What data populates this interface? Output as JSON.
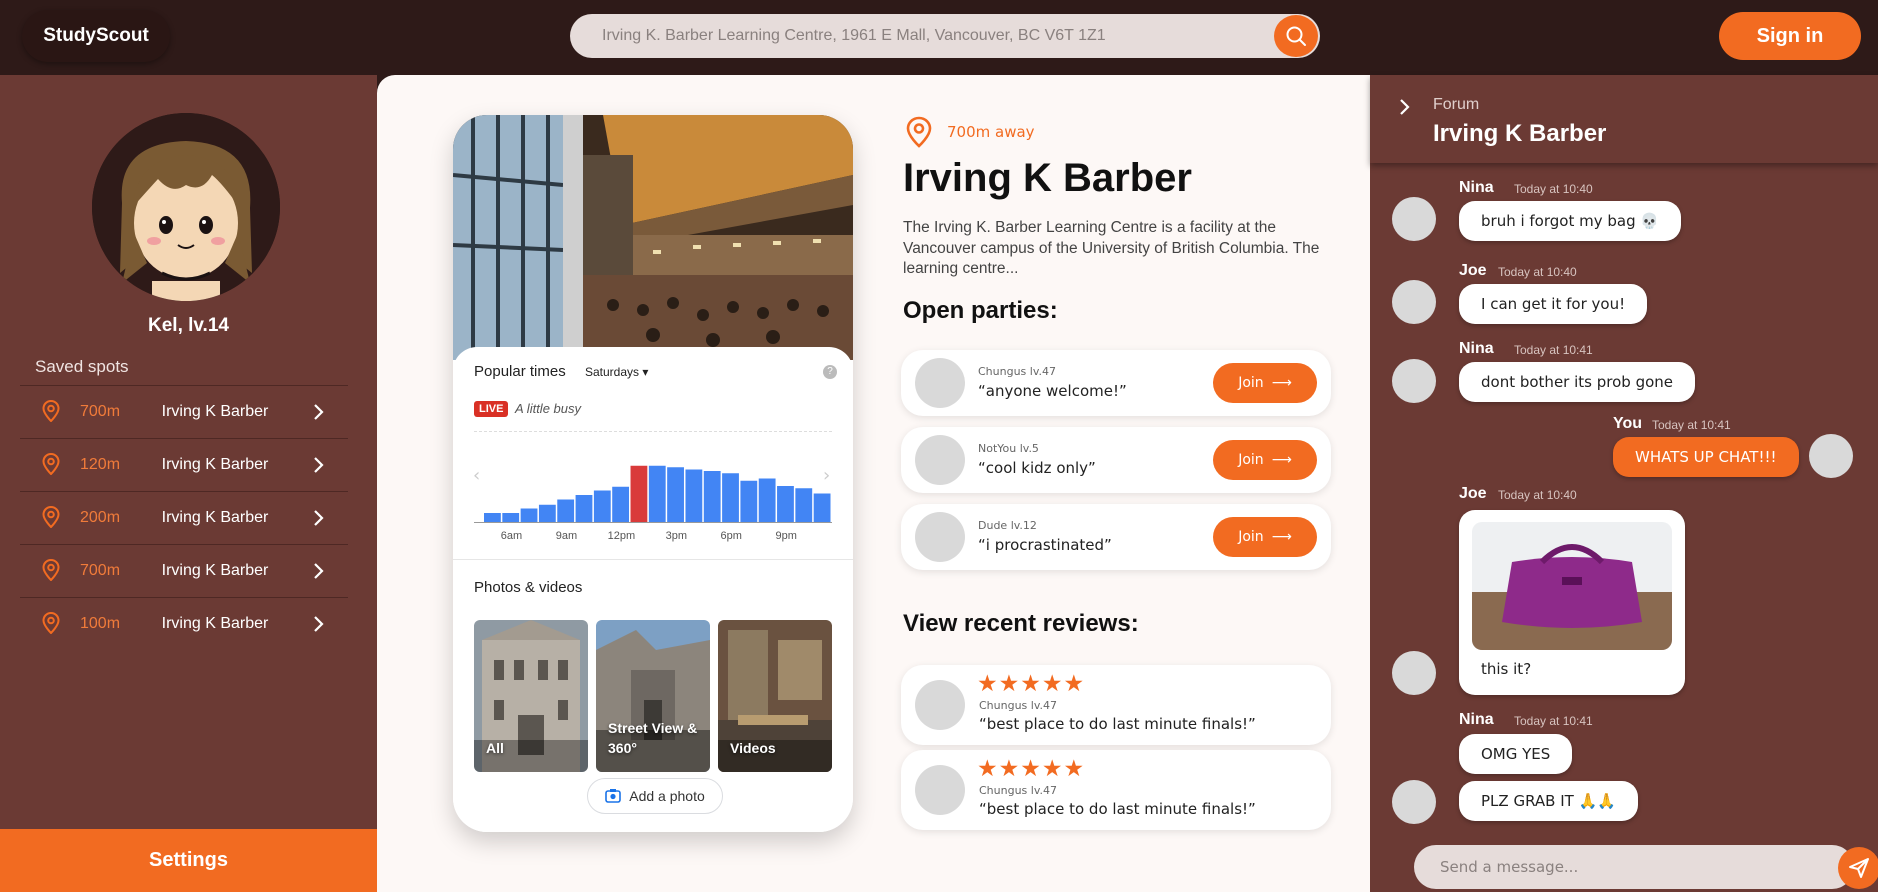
{
  "header": {
    "logo": "StudyScout",
    "search_placeholder": "Irving K. Barber Learning Centre, 1961 E Mall, Vancouver, BC V6T 1Z1",
    "signin_label": "Sign in"
  },
  "sidebar": {
    "username": "Kel, lv.14",
    "saved_title": "Saved spots",
    "spots": [
      {
        "distance": "700m",
        "name": "Irving K Barber"
      },
      {
        "distance": "120m",
        "name": "Irving K Barber"
      },
      {
        "distance": "200m",
        "name": "Irving K Barber"
      },
      {
        "distance": "700m",
        "name": "Irving K Barber"
      },
      {
        "distance": "100m",
        "name": "Irving K Barber"
      }
    ],
    "settings_label": "Settings"
  },
  "place": {
    "distance": "700m away",
    "title": "Irving K Barber",
    "description": "The Irving K. Barber Learning Centre is a facility at the Vancouver campus of the University of British Columbia. The learning centre...",
    "parties_title": "Open parties:",
    "parties": [
      {
        "host": "Chungus lv.47",
        "quote": "“anyone welcome!”",
        "join": "Join"
      },
      {
        "host": "NotYou lv.5",
        "quote": "“cool kidz only”",
        "join": "Join"
      },
      {
        "host": "Dude lv.12",
        "quote": "“i procrastinated”",
        "join": "Join"
      }
    ],
    "reviews_title": "View recent reviews:",
    "reviews": [
      {
        "stars": "★★★★★",
        "author": "Chungus lv.47",
        "quote": "“best place to do last minute finals!”"
      },
      {
        "stars": "★★★★★",
        "author": "Chungus lv.47",
        "quote": "“best place to do last minute finals!”"
      }
    ]
  },
  "popular_times": {
    "title": "Popular times",
    "day": "Saturdays",
    "help": "?",
    "live": "LIVE",
    "busy": "A little busy",
    "ticks": [
      "6am",
      "9am",
      "12pm",
      "3pm",
      "6pm",
      "9pm"
    ],
    "bar_levels": [
      0.12,
      0.12,
      0.18,
      0.23,
      0.3,
      0.36,
      0.42,
      0.47,
      0.75,
      0.75,
      0.73,
      0.7,
      0.68,
      0.65,
      0.55,
      0.58,
      0.48,
      0.45,
      0.38
    ],
    "live_index": 8,
    "bar_color": "#4285f4",
    "live_color": "#d93a3a",
    "photos_title": "Photos & videos",
    "thumbs": [
      "All",
      "Street View & 360°",
      "Videos"
    ],
    "add_photo": "Add a photo"
  },
  "forum": {
    "label": "Forum",
    "title": "Irving K Barber",
    "messages": [
      {
        "author": "Nina",
        "time": "Today at 10:40",
        "text": "bruh i forgot my bag 💀"
      },
      {
        "author": "Joe",
        "time": "Today at 10:40",
        "text": "I can get it for you!"
      },
      {
        "author": "Nina",
        "time": "Today at 10:41",
        "text": "dont bother its prob gone"
      },
      {
        "author": "You",
        "time": "Today at 10:41",
        "text": "WHATS UP CHAT!!!"
      },
      {
        "author": "Joe",
        "time": "Today at 10:40",
        "text": "this it?"
      },
      {
        "author": "Nina",
        "time": "Today at 10:41",
        "text": "OMG YES"
      },
      {
        "author": "Nina",
        "time": "",
        "text": "PLZ GRAB IT 🙏🙏"
      }
    ],
    "send_placeholder": "Send a message..."
  },
  "colors": {
    "accent": "#f26b21",
    "panel": "#6b3a34",
    "topbar": "#2e1a18"
  }
}
